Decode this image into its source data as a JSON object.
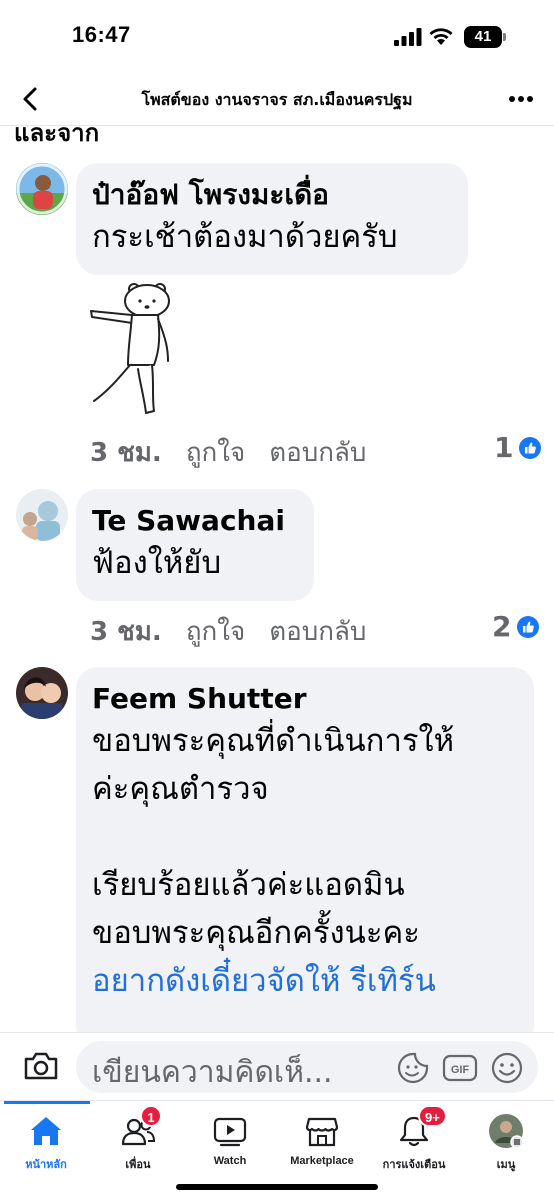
{
  "status_bar": {
    "time": "16:47",
    "battery": "41"
  },
  "header": {
    "title": "โพสต์ของ งานจราจร สภ.เมืองนครปฐม"
  },
  "feed": {
    "cut_text": "และจาก"
  },
  "comments": [
    {
      "author": "ป๋าอ๊อฟ โพรงมะเดื่อ",
      "text": "กระเช้าต้องมาด้วยครับ",
      "time": "3 ชม.",
      "like_label": "ถูกใจ",
      "reply_label": "ตอบกลับ",
      "reaction_count": "1"
    },
    {
      "author": "Te Sawachai",
      "text": "ฟ้องให้ยับ",
      "time": "3 ชม.",
      "like_label": "ถูกใจ",
      "reply_label": "ตอบกลับ",
      "reaction_count": "2"
    },
    {
      "author": "Feem Shutter",
      "lines": [
        "ขอบพระคุณที่ดำเนินการให้",
        "ค่ะคุณตำรวจ",
        "",
        "เรียบร้อยแล้วค่ะแอดมิน",
        "ขอบพระคุณอีกครั้งนะคะ"
      ],
      "link_text": "อยากดังเดี๋ยวจัดให้ รีเทิร์น"
    }
  ],
  "composer": {
    "placeholder": "เขียนความคิดเห็..."
  },
  "tabs": [
    {
      "label": "หน้าหลัก",
      "icon": "home-icon"
    },
    {
      "label": "เพื่อน",
      "icon": "friends-icon",
      "badge": "1"
    },
    {
      "label": "Watch",
      "icon": "watch-icon"
    },
    {
      "label": "Marketplace",
      "icon": "marketplace-icon"
    },
    {
      "label": "การแจ้งเตือน",
      "icon": "bell-icon",
      "badge": "9+"
    },
    {
      "label": "เมนู",
      "icon": "menu-avatar-icon"
    }
  ],
  "colors": {
    "accent": "#1877f2",
    "badge": "#e41e3f",
    "bubble": "#f0f2f5",
    "link": "#216fdb"
  }
}
